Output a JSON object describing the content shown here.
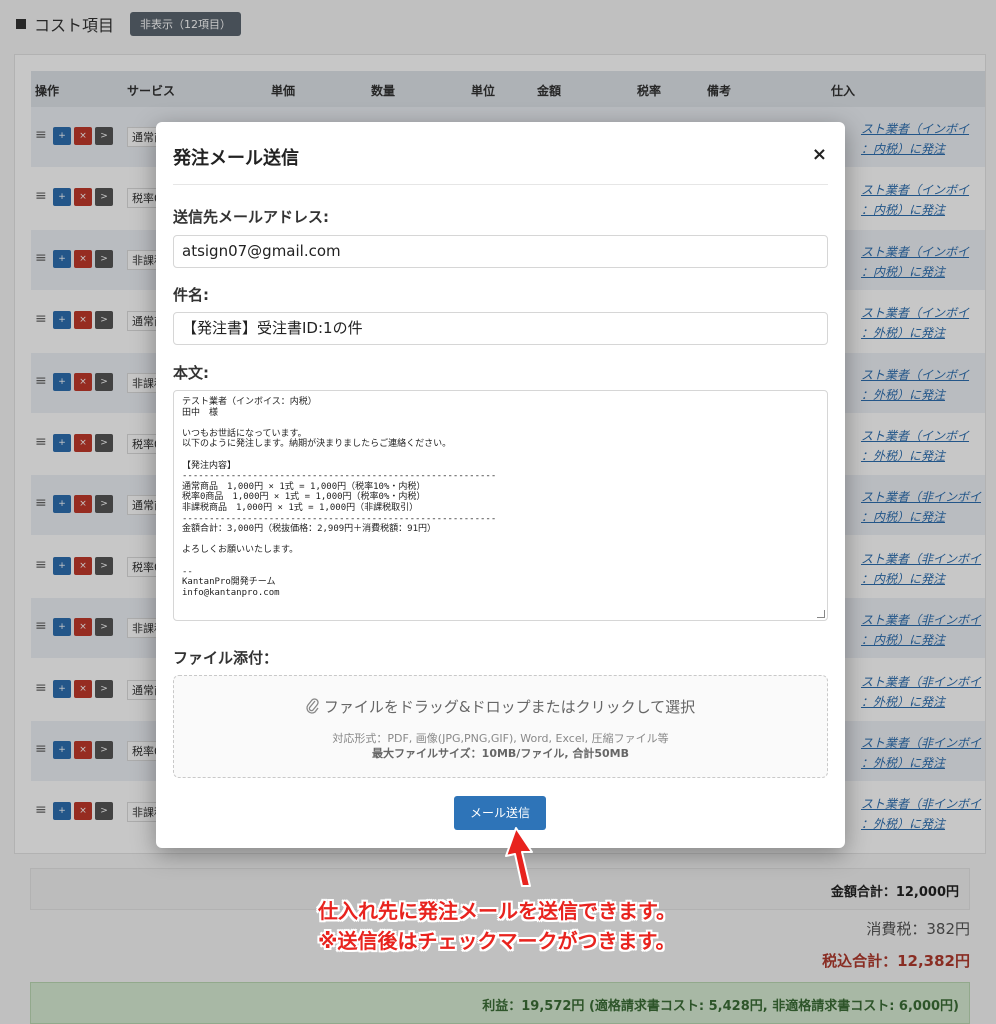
{
  "section": {
    "title": "コスト項目",
    "toggle_label": "非表示（12項目）"
  },
  "table": {
    "headers": [
      "操作",
      "サービス",
      "単価",
      "数量",
      "単位",
      "金額",
      "税率",
      "備考",
      "仕入"
    ],
    "rows": [
      {
        "service": "通常商",
        "vendor_line1": "スト業者（インボイ",
        "vendor_line2": "：内税）に発注"
      },
      {
        "service": "税率0",
        "vendor_line1": "スト業者（インボイ",
        "vendor_line2": "：内税）に発注"
      },
      {
        "service": "非課税",
        "vendor_line1": "スト業者（インボイ",
        "vendor_line2": "：内税）に発注"
      },
      {
        "service": "通常商",
        "vendor_line1": "スト業者（インボイ",
        "vendor_line2": "：外税）に発注"
      },
      {
        "service": "非課税",
        "vendor_line1": "スト業者（インボイ",
        "vendor_line2": "：外税）に発注"
      },
      {
        "service": "税率0",
        "vendor_line1": "スト業者（インボイ",
        "vendor_line2": "：外税）に発注"
      },
      {
        "service": "通常商",
        "vendor_line1": "スト業者（非インボイ",
        "vendor_line2": "：内税）に発注"
      },
      {
        "service": "税率0",
        "vendor_line1": "スト業者（非インボイ",
        "vendor_line2": "：内税）に発注"
      },
      {
        "service": "非課税",
        "vendor_line1": "スト業者（非インボイ",
        "vendor_line2": "：内税）に発注"
      },
      {
        "service": "通常商",
        "vendor_line1": "スト業者（非インボイ",
        "vendor_line2": "：外税）に発注"
      },
      {
        "service": "税率0",
        "vendor_line1": "スト業者（非インボイ",
        "vendor_line2": "：外税）に発注"
      },
      {
        "service": "非課税",
        "vendor_line1": "スト業者（非インボイ",
        "vendor_line2": "：外税）に発注"
      }
    ],
    "row_buttons": {
      "add": "+",
      "delete": "×",
      "go": ">"
    }
  },
  "summary": {
    "amount_total": "金額合計：12,000円",
    "tax": "消費税：382円",
    "total_incl_tax": "税込合計：12,382円",
    "profit": "利益：19,572円 (適格請求書コスト: 5,428円, 非適格請求書コスト: 6,000円)"
  },
  "modal": {
    "title": "発注メール送信",
    "close": "×",
    "to_label": "送信先メールアドレス:",
    "to_value": "atsign07@gmail.com",
    "subject_label": "件名:",
    "subject_value": "【発注書】受注書ID:1の件",
    "body_label": "本文:",
    "body_lines": [
      "テスト業者（インボイス：内税）",
      "田中　様",
      "",
      "いつもお世話になっています。",
      "以下のように発注します。納期が決まりましたらご連絡ください。",
      "",
      "【発注内容】",
      "----------------------------------------------------------",
      "通常商品　1,000円 × 1式 = 1,000円（税率10%・内税）",
      "税率0商品　1,000円 × 1式 = 1,000円（税率0%・内税）",
      "非課税商品　1,000円 × 1式 = 1,000円（非課税取引）",
      "----------------------------------------------------------",
      "金額合計：3,000円（税抜価格：2,909円＋消費税額：91円）",
      "",
      "よろしくお願いいたします。",
      "",
      "--",
      "KantanPro開発チーム",
      "info@kantanpro.com"
    ],
    "attach_label": "ファイル添付：",
    "dropzone_text": "ファイルをドラッグ&ドロップまたはクリックして選択",
    "dropzone_formats": "対応形式：PDF, 画像(JPG,PNG,GIF), Word, Excel, 圧縮ファイル等",
    "dropzone_size": "最大ファイルサイズ：10MB/ファイル, 合計50MB",
    "send_label": "メール送信"
  },
  "annotation": {
    "line1": "仕入れ先に発注メールを送信できます。",
    "line2": "※送信後はチェックマークがつきます。",
    "color": "#e8231e"
  },
  "icons": {
    "attach": "paperclip-icon",
    "drag": "drag-handle-icon"
  }
}
